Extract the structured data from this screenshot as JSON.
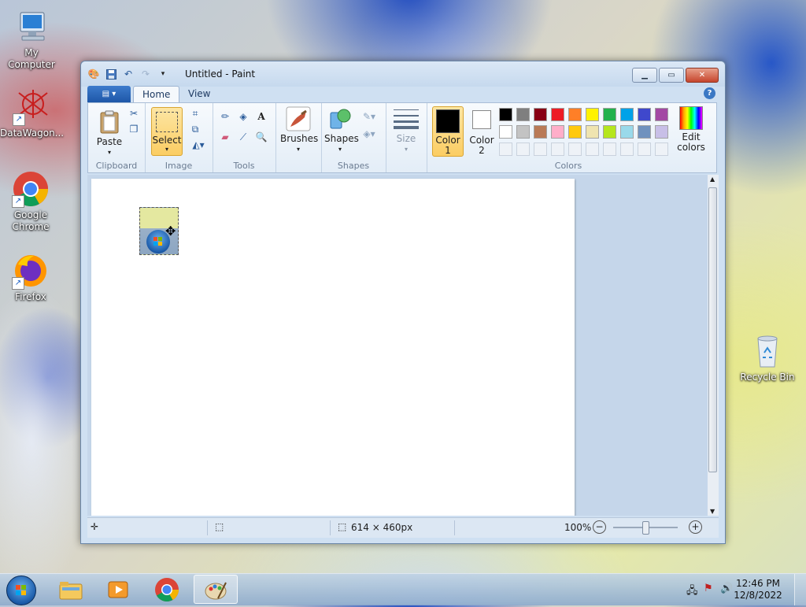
{
  "desktop": {
    "icons": [
      {
        "label": "My Computer"
      },
      {
        "label": "DataWagon..."
      },
      {
        "label": "Google Chrome"
      },
      {
        "label": "Firefox"
      },
      {
        "label": "Recycle Bin"
      }
    ]
  },
  "window": {
    "title": "Untitled - Paint",
    "tabs": [
      {
        "label": "Home"
      },
      {
        "label": "View"
      }
    ],
    "help": "?"
  },
  "ribbon": {
    "clipboard": {
      "paste": "Paste",
      "group": "Clipboard"
    },
    "image": {
      "select": "Select",
      "group": "Image"
    },
    "tools": {
      "group": "Tools"
    },
    "brushes": "Brushes",
    "shapes": {
      "label": "Shapes",
      "group": "Shapes"
    },
    "size": "Size",
    "colors": {
      "color1": "Color 1",
      "color2": "Color 2",
      "edit": "Edit colors",
      "group": "Colors",
      "color1_value": "#000000",
      "color2_value": "#ffffff",
      "palette_row1": [
        "#000000",
        "#7f7f7f",
        "#880015",
        "#ed1c24",
        "#ff7f27",
        "#fff200",
        "#22b14c",
        "#00a2e8",
        "#3f48cc",
        "#a349a4"
      ],
      "palette_row2": [
        "#ffffff",
        "#c3c3c3",
        "#b97a57",
        "#ffaec9",
        "#ffc90e",
        "#efe4b0",
        "#b5e61d",
        "#99d9ea",
        "#7092be",
        "#c8bfe7"
      ]
    }
  },
  "status": {
    "dimensions": "614 × 460px",
    "zoom": "100%"
  },
  "taskbar": {
    "time": "12:46 PM",
    "date": "12/8/2022"
  }
}
